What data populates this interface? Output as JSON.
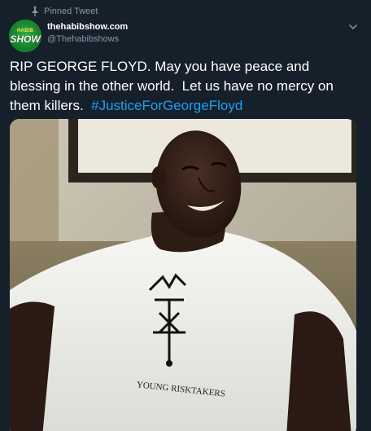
{
  "pinned": {
    "label": "Pinned Tweet",
    "icon": "pin-icon"
  },
  "author": {
    "avatar_top": "HABIB",
    "avatar_main": "SHOW",
    "display_name": "thehabibshow.com",
    "handle": "@Thehabibshows"
  },
  "menu": {
    "icon": "chevron-down-icon"
  },
  "tweet": {
    "text": "RIP GEORGE FLOYD. May you have peace and blessing in the other world.  Let us have no mercy on them killers.  ",
    "hashtag": "#JusticeForGeorgeFloyd"
  },
  "media": {
    "shirt_text": "YOUNG RISKTAKERS"
  },
  "colors": {
    "background": "#15202b",
    "secondary_text": "#8899a6",
    "link": "#1da1f2",
    "avatar_green": "#1d8a34"
  }
}
